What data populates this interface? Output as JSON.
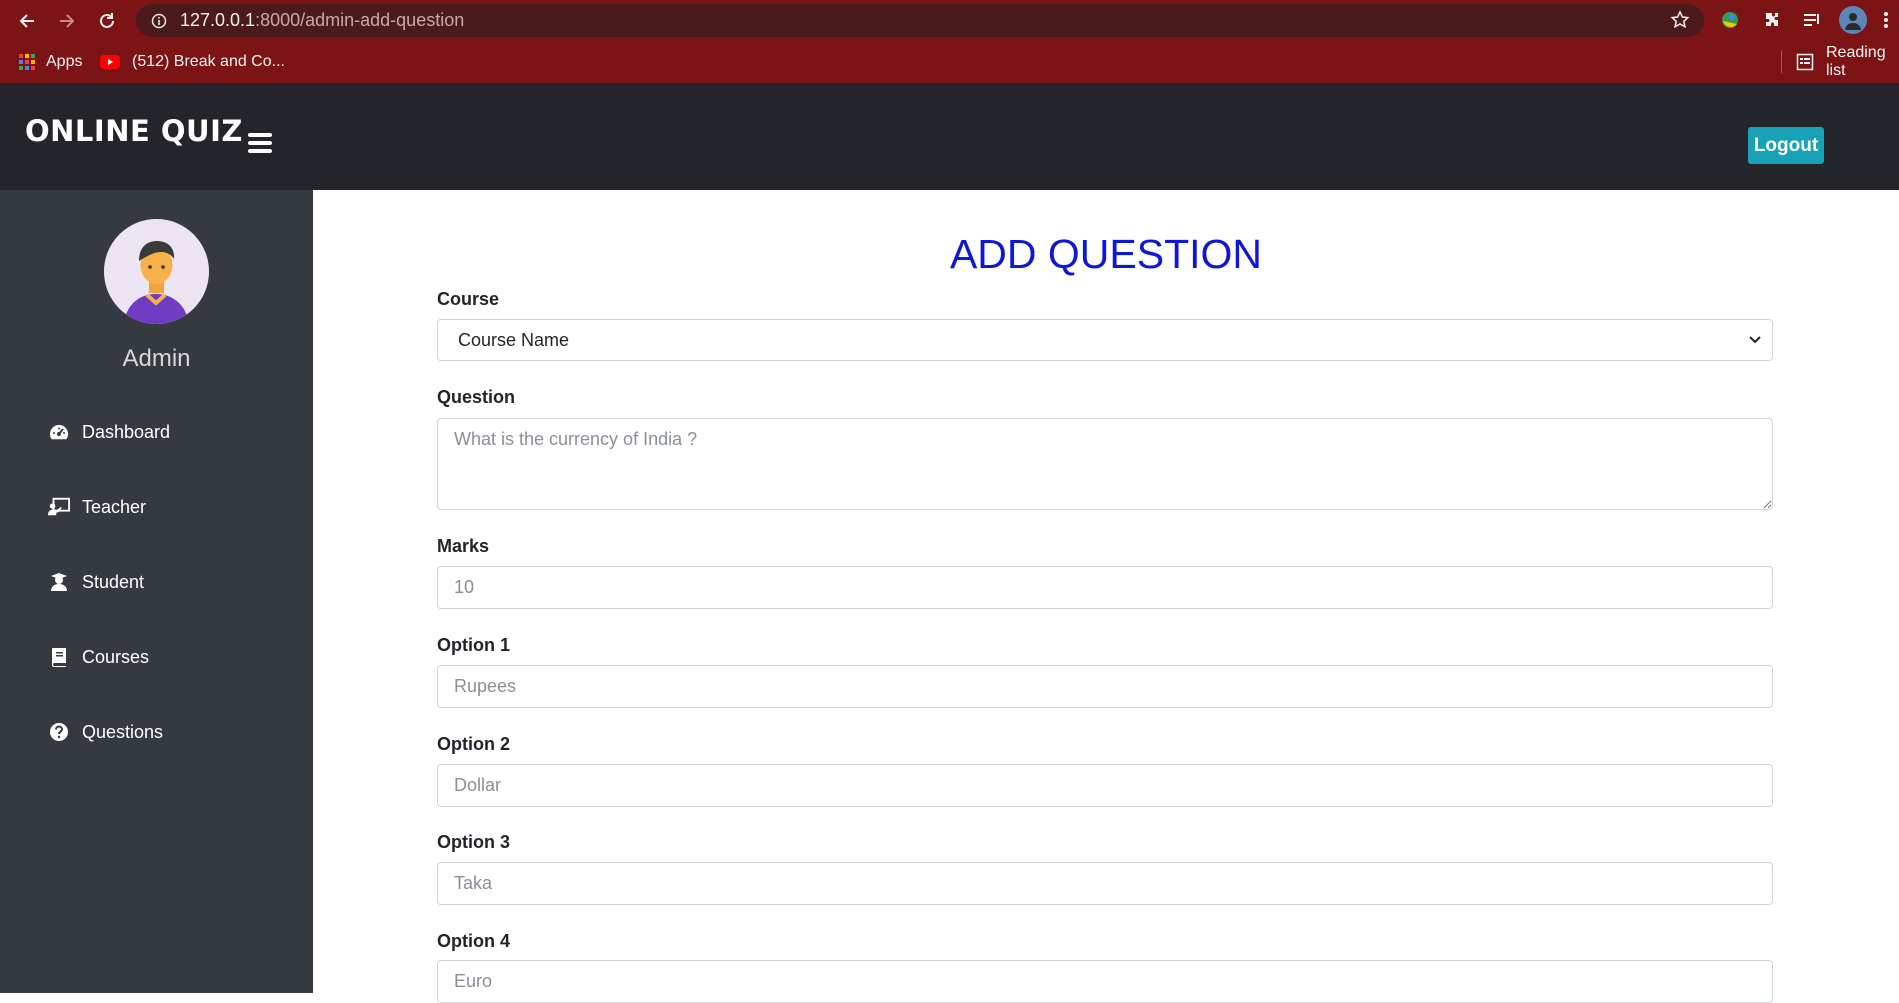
{
  "browser": {
    "url_host": "127.0.0.1",
    "url_path": ":8000/admin-add-question",
    "bookmarks": {
      "apps_label": "Apps",
      "youtube_label": "(512) Break and Co...",
      "reading_list_label": "Reading list"
    }
  },
  "app": {
    "brand": "ONLINE QUIZ",
    "logout_label": "Logout"
  },
  "sidebar": {
    "user_name": "Admin",
    "items": [
      {
        "label": "Dashboard",
        "icon": "dashboard-icon"
      },
      {
        "label": "Teacher",
        "icon": "teacher-icon"
      },
      {
        "label": "Student",
        "icon": "student-icon"
      },
      {
        "label": "Courses",
        "icon": "book-icon"
      },
      {
        "label": "Questions",
        "icon": "question-circle-icon"
      }
    ]
  },
  "form": {
    "title": "ADD QUESTION",
    "course_label": "Course",
    "course_value": "Course Name",
    "question_label": "Question",
    "question_placeholder": "What is the currency of India ?",
    "marks_label": "Marks",
    "marks_placeholder": "10",
    "option1_label": "Option 1",
    "option1_placeholder": "Rupees",
    "option2_label": "Option 2",
    "option2_placeholder": "Dollar",
    "option3_label": "Option 3",
    "option3_placeholder": "Taka",
    "option4_label": "Option 4",
    "option4_placeholder": "Euro"
  }
}
